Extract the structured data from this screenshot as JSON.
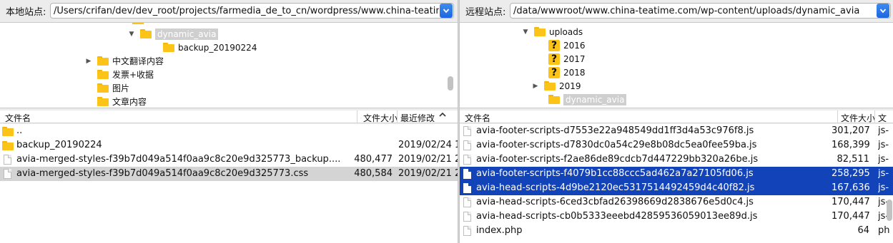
{
  "local": {
    "label": "本地站点:",
    "path": "/Users/crifan/dev/dev_root/projects/farmedia_de_to_cn/wordpress/www.china-teatime.com",
    "tree": [
      {
        "name": "dynamic_avia",
        "arrow": "▼",
        "icon": "folder",
        "selected": true
      },
      {
        "name": "backup_20190224",
        "arrow": "",
        "icon": "folder",
        "selected": false
      },
      {
        "name": "中文翻译内容",
        "arrow": "▶",
        "icon": "folder",
        "selected": false
      },
      {
        "name": "发票+收据",
        "arrow": "",
        "icon": "folder",
        "selected": false
      },
      {
        "name": "图片",
        "arrow": "",
        "icon": "folder",
        "selected": false
      },
      {
        "name": "文章内容",
        "arrow": "",
        "icon": "folder",
        "selected": false
      }
    ],
    "columns": {
      "name": "文件名",
      "size": "文件大小",
      "modified": "最近修改"
    },
    "sort_indicator": "^",
    "files": [
      {
        "name": "..",
        "size": "",
        "modified": "",
        "icon": "folder",
        "state": "normal"
      },
      {
        "name": "backup_20190224",
        "size": "",
        "modified": "2019/02/24 1",
        "icon": "folder",
        "state": "normal"
      },
      {
        "name": "avia-merged-styles-f39b7d049a514f0aa9c8c20e9d325773_backup....",
        "size": "480,477",
        "modified": "2019/02/21 2",
        "icon": "file",
        "state": "normal"
      },
      {
        "name": "avia-merged-styles-f39b7d049a514f0aa9c8c20e9d325773.css",
        "size": "480,584",
        "modified": "2019/02/21 2",
        "icon": "file",
        "state": "gray"
      }
    ]
  },
  "remote": {
    "label": "远程站点:",
    "path": "/data/wwwroot/www.china-teatime.com/wp-content/uploads/dynamic_avia",
    "tree": [
      {
        "name": "uploads",
        "arrow": "▼",
        "icon": "folder",
        "selected": false
      },
      {
        "name": "2016",
        "arrow": "",
        "icon": "question",
        "selected": false
      },
      {
        "name": "2017",
        "arrow": "",
        "icon": "question",
        "selected": false
      },
      {
        "name": "2018",
        "arrow": "",
        "icon": "question",
        "selected": false
      },
      {
        "name": "2019",
        "arrow": "▶",
        "icon": "folder",
        "selected": false
      },
      {
        "name": "dynamic_avia",
        "arrow": "",
        "icon": "folder",
        "selected": true
      }
    ],
    "columns": {
      "name": "文件名",
      "size": "文件大小",
      "type": "文"
    },
    "files": [
      {
        "name": "avia-footer-scripts-d7553e22a948549dd1ff3d4a53c976f8.js",
        "size": "301,207",
        "type": "js-",
        "state": "normal"
      },
      {
        "name": "avia-footer-scripts-d7830dc0a54c29e8b08dc5ea0fee59ba.js",
        "size": "168,399",
        "type": "js-",
        "state": "normal"
      },
      {
        "name": "avia-footer-scripts-f2ae86de89cdcb7d447229bb320a26be.js",
        "size": "82,511",
        "type": "js-",
        "state": "normal"
      },
      {
        "name": "avia-footer-scripts-f4079b1cc88ccc5ad462a7a27105fd06.js",
        "size": "258,295",
        "type": "js-",
        "state": "blue"
      },
      {
        "name": "avia-head-scripts-4d9be2120ec5317514492459d4c40f82.js",
        "size": "167,636",
        "type": "js-",
        "state": "blue"
      },
      {
        "name": "avia-head-scripts-6ced3cbfad26398669d2838676e5d0c4.js",
        "size": "170,447",
        "type": "js-",
        "state": "normal"
      },
      {
        "name": "avia-head-scripts-cb0b5333eeebd42859536059013ee89d.js",
        "size": "170,447",
        "type": "js-",
        "state": "normal"
      },
      {
        "name": "index.php",
        "size": "64",
        "type": "ph",
        "state": "normal"
      }
    ]
  }
}
